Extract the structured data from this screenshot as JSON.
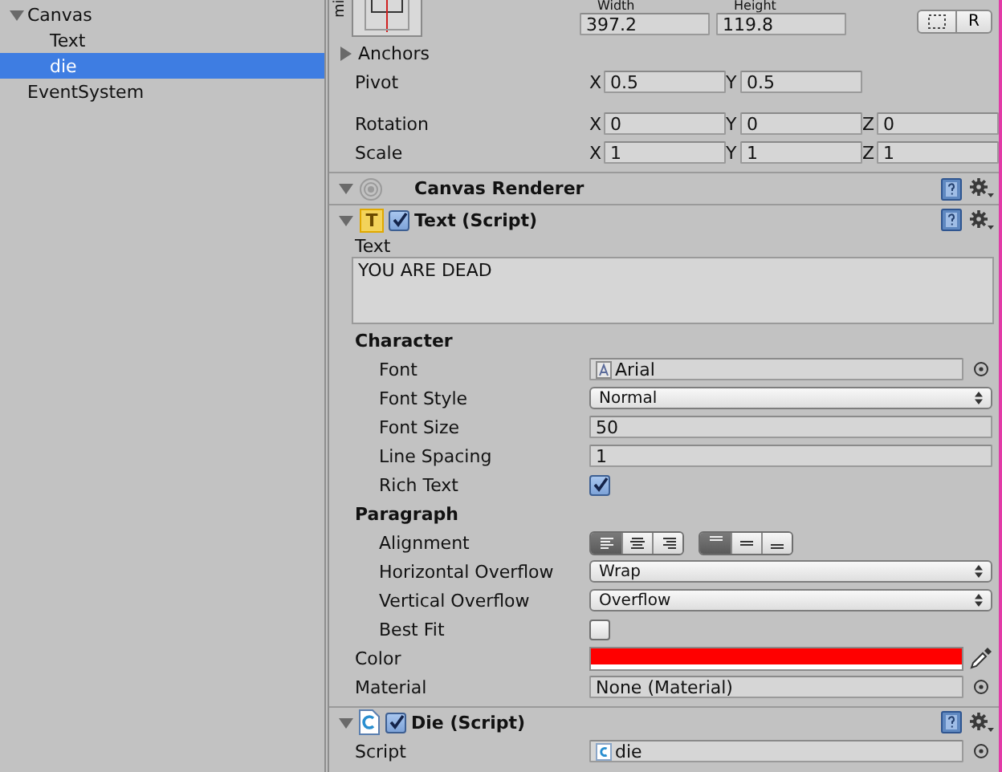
{
  "hierarchy": [
    {
      "label": "Canvas",
      "expanded": true,
      "selected": false,
      "children": [
        {
          "label": "Text",
          "selected": false
        },
        {
          "label": "die",
          "selected": true
        }
      ]
    },
    {
      "label": "EventSystem",
      "selected": false
    }
  ],
  "rect_transform": {
    "side_label": "mi",
    "size": [
      {
        "label": "Width",
        "value": "397.2"
      },
      {
        "label": "Height",
        "value": "119.8"
      }
    ],
    "raw_button": "R",
    "anchors": {
      "label": "Anchors",
      "expanded": false
    },
    "vectors": [
      {
        "label": "Pivot",
        "fields": [
          {
            "axis": "X",
            "value": "0.5"
          },
          {
            "axis": "Y",
            "value": "0.5"
          }
        ]
      },
      {
        "label": "Rotation",
        "fields": [
          {
            "axis": "X",
            "value": "0"
          },
          {
            "axis": "Y",
            "value": "0"
          },
          {
            "axis": "Z",
            "value": "0"
          }
        ]
      },
      {
        "label": "Scale",
        "fields": [
          {
            "axis": "X",
            "value": "1"
          },
          {
            "axis": "Y",
            "value": "1"
          },
          {
            "axis": "Z",
            "value": "1"
          }
        ]
      }
    ]
  },
  "components": [
    {
      "kind": "canvas_renderer",
      "title": "Canvas Renderer",
      "expanded": true
    },
    {
      "kind": "text",
      "icon_glyph": "T",
      "title": "Text (Script)",
      "expanded": true,
      "enabled": true,
      "rows": [
        {
          "kind": "textarea",
          "label": "Text",
          "value": "YOU ARE DEAD"
        },
        {
          "kind": "section",
          "label": "Character",
          "rows": [
            {
              "kind": "object",
              "label": "Font",
              "value": "Arial",
              "asset": {
                "kind": "font"
              }
            },
            {
              "kind": "dropdown",
              "label": "Font Style",
              "value": "Normal"
            },
            {
              "kind": "field",
              "label": "Font Size",
              "value": "50"
            },
            {
              "kind": "field",
              "label": "Line Spacing",
              "value": "1"
            },
            {
              "kind": "checkbox",
              "label": "Rich Text",
              "checked": true
            }
          ]
        },
        {
          "kind": "section",
          "label": "Paragraph",
          "rows": [
            {
              "kind": "alignment",
              "label": "Alignment",
              "horizontal": [
                {
                  "selected": true
                },
                {
                  "selected": false
                },
                {
                  "selected": false
                }
              ],
              "vertical": [
                {
                  "selected": true
                },
                {
                  "selected": false
                },
                {
                  "selected": false
                }
              ]
            },
            {
              "kind": "dropdown",
              "label": "Horizontal Overflow",
              "value": "Wrap"
            },
            {
              "kind": "dropdown",
              "label": "Vertical Overflow",
              "value": "Overflow"
            },
            {
              "kind": "checkbox",
              "label": "Best Fit",
              "checked": false
            }
          ]
        },
        {
          "kind": "color",
          "label": "Color",
          "color": "#ff0000"
        },
        {
          "kind": "object",
          "label": "Material",
          "value": "None (Material)"
        }
      ]
    },
    {
      "kind": "script",
      "title": "Die (Script)",
      "expanded": true,
      "enabled": true,
      "rows": [
        {
          "kind": "object",
          "label": "Script",
          "value": "die",
          "asset": {
            "kind": "script"
          }
        }
      ]
    }
  ]
}
